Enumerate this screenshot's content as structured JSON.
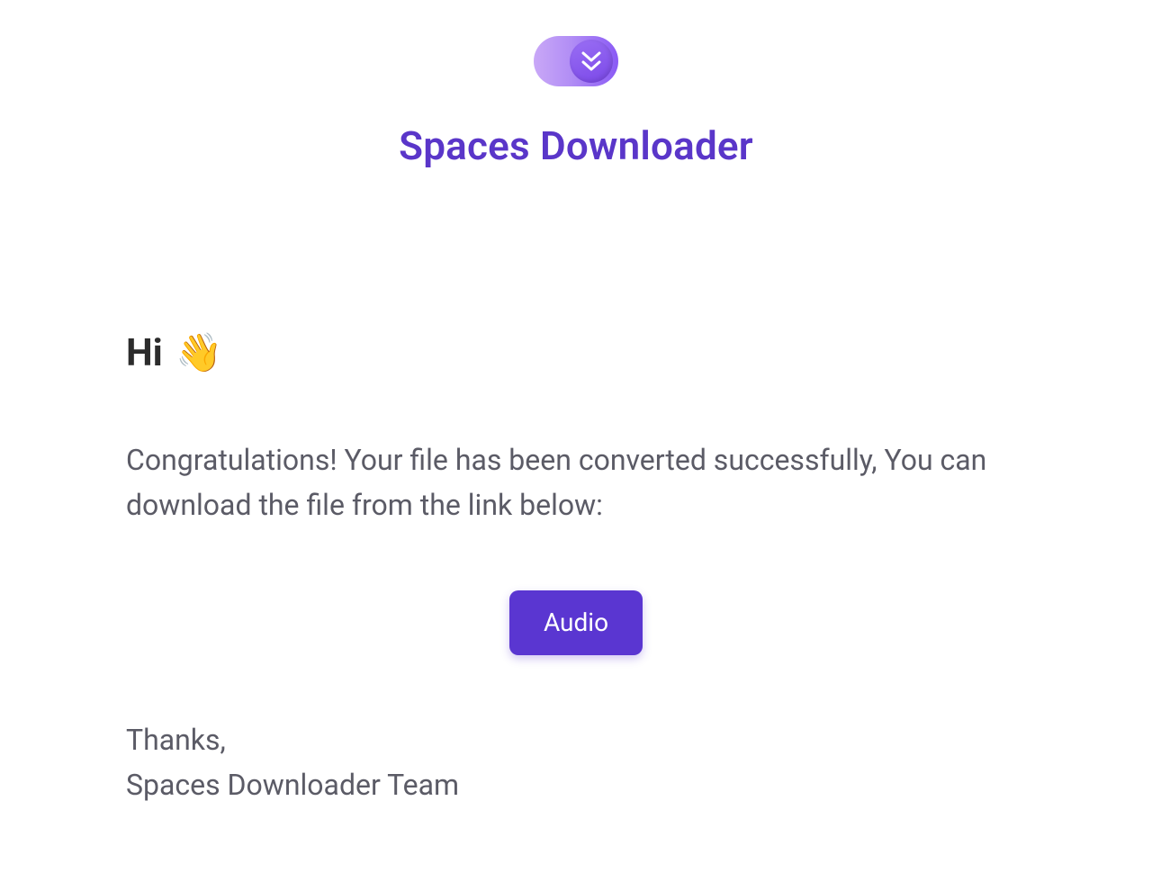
{
  "header": {
    "title": "Spaces Downloader"
  },
  "body": {
    "greeting_text": "Hi ",
    "greeting_emoji": "👋",
    "message": "Congratulations! Your file has been converted successfully, You can download the file from the link below:"
  },
  "cta": {
    "audio_label": "Audio"
  },
  "signoff": {
    "thanks": "Thanks,",
    "team": "Spaces Downloader Team"
  },
  "colors": {
    "brand": "#5a36c9",
    "button": "#5a36d1",
    "text_muted": "#5b5b66"
  }
}
